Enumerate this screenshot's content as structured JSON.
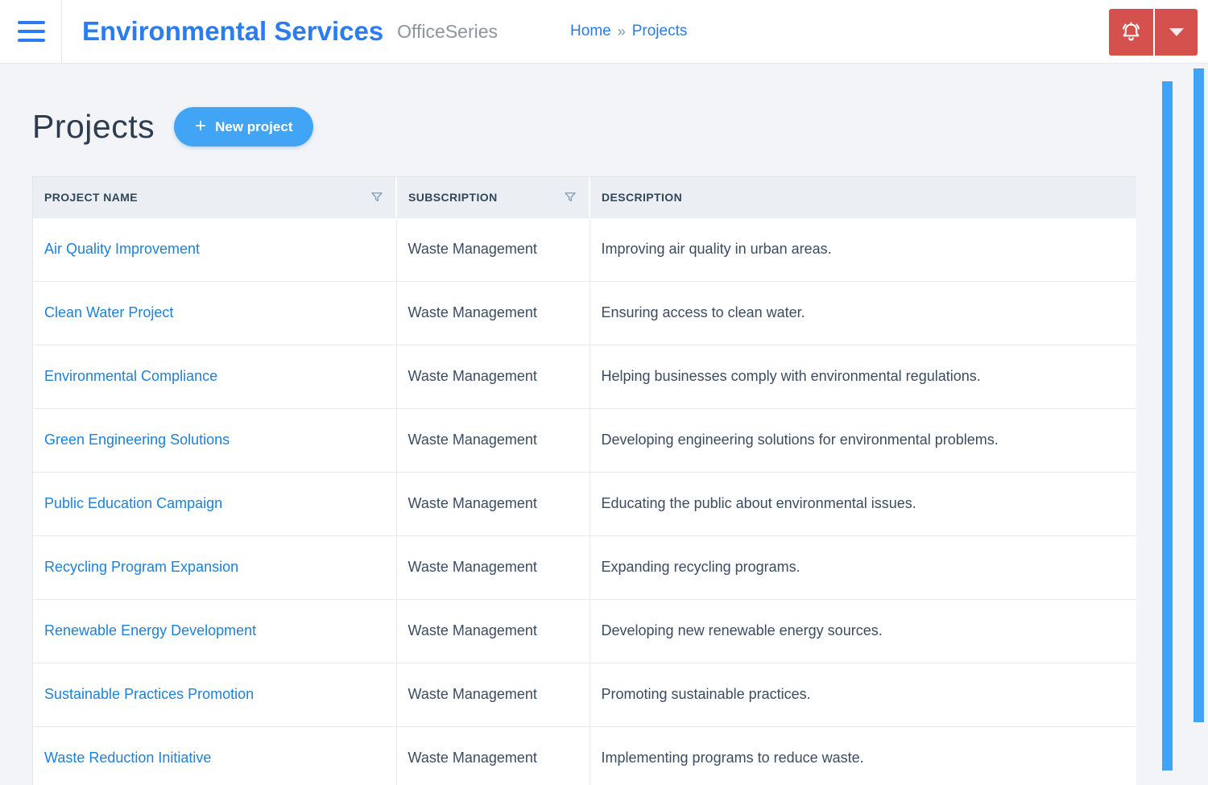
{
  "header": {
    "brand": "Environmental Services",
    "suite": "OfficeSeries",
    "breadcrumb": {
      "home": "Home",
      "separator": "»",
      "current": "Projects"
    }
  },
  "page": {
    "title": "Projects",
    "new_project": {
      "plus": "+",
      "label": "New project"
    }
  },
  "table": {
    "columns": [
      {
        "label": "PROJECT NAME"
      },
      {
        "label": "SUBSCRIPTION"
      },
      {
        "label": "DESCRIPTION"
      }
    ],
    "rows": [
      {
        "name": "Air Quality Improvement",
        "subscription": "Waste Management",
        "description": "Improving air quality in urban areas."
      },
      {
        "name": "Clean Water Project",
        "subscription": "Waste Management",
        "description": "Ensuring access to clean water."
      },
      {
        "name": "Environmental Compliance",
        "subscription": "Waste Management",
        "description": "Helping businesses comply with environmental regulations."
      },
      {
        "name": "Green Engineering Solutions",
        "subscription": "Waste Management",
        "description": "Developing engineering solutions for environmental problems."
      },
      {
        "name": "Public Education Campaign",
        "subscription": "Waste Management",
        "description": "Educating the public about environmental issues."
      },
      {
        "name": "Recycling Program Expansion",
        "subscription": "Waste Management",
        "description": "Expanding recycling programs."
      },
      {
        "name": "Renewable Energy Development",
        "subscription": "Waste Management",
        "description": "Developing new renewable energy sources."
      },
      {
        "name": "Sustainable Practices Promotion",
        "subscription": "Waste Management",
        "description": "Promoting sustainable practices."
      },
      {
        "name": "Waste Reduction Initiative",
        "subscription": "Waste Management",
        "description": "Implementing programs to reduce waste."
      }
    ]
  },
  "icons": {
    "hamburger": "hamburger-menu",
    "bell": "notification-bell",
    "caret": "chevron-down",
    "filter": "filter-funnel"
  },
  "colors": {
    "brand_blue": "#2b7cf1",
    "button_blue": "#41a4f5",
    "link_blue": "#1f81d6",
    "scrollbar_blue": "#3fa3f7",
    "danger_red": "#d5514d",
    "text_dark": "#33475b",
    "page_background": "#f2f4f7",
    "table_header_background": "#ebeef2"
  }
}
